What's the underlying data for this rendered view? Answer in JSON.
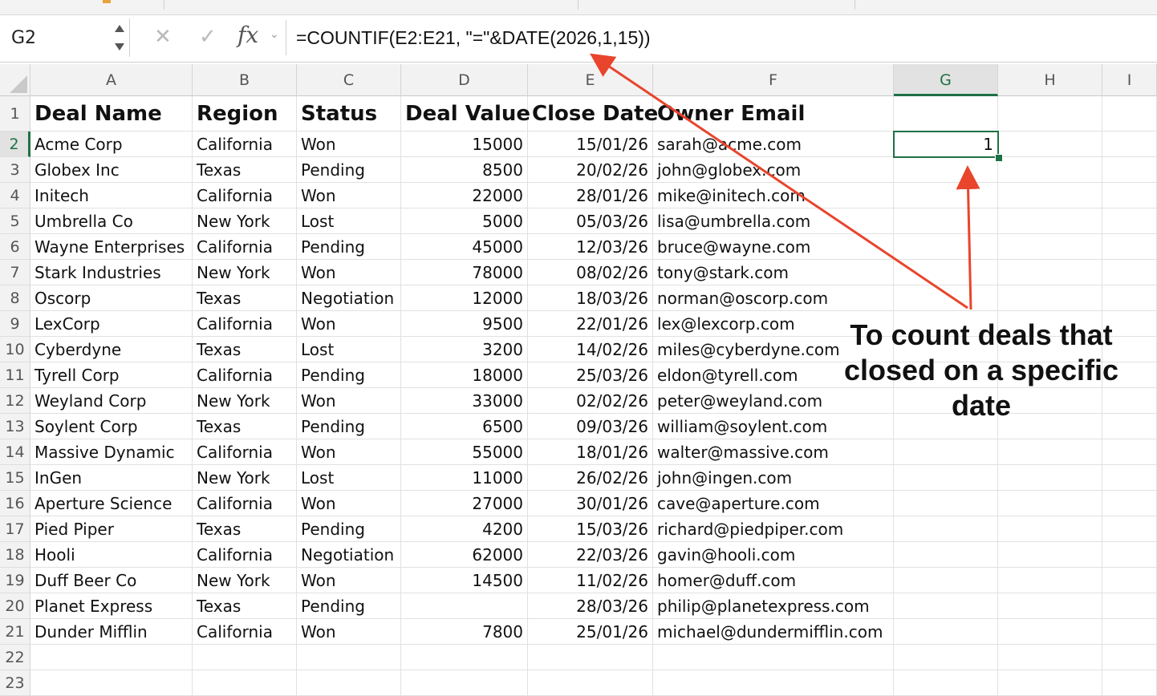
{
  "formula_bar": {
    "name_box": "G2",
    "fx_label": "fx",
    "cancel_glyph": "✕",
    "enter_glyph": "✓",
    "formula": "=COUNTIF(E2:E21, \"=\"&DATE(2026,1,15))"
  },
  "columns": [
    {
      "letter": "A",
      "width": 202
    },
    {
      "letter": "B",
      "width": 130
    },
    {
      "letter": "C",
      "width": 130
    },
    {
      "letter": "D",
      "width": 158
    },
    {
      "letter": "E",
      "width": 156
    },
    {
      "letter": "F",
      "width": 300
    },
    {
      "letter": "G",
      "width": 130
    },
    {
      "letter": "H",
      "width": 130
    },
    {
      "letter": "I",
      "width": 68
    }
  ],
  "selected_cell": {
    "col": "G",
    "row": 2
  },
  "headers": [
    "Deal Name",
    "Region",
    "Status",
    "Deal Value",
    "Close Date",
    "Owner Email"
  ],
  "rows": [
    [
      "Acme Corp",
      "California",
      "Won",
      "15000",
      "15/01/26",
      "sarah@acme.com"
    ],
    [
      "Globex Inc",
      "Texas",
      "Pending",
      "8500",
      "20/02/26",
      "john@globex.com"
    ],
    [
      "Initech",
      "California",
      "Won",
      "22000",
      "28/01/26",
      "mike@initech.com"
    ],
    [
      "Umbrella Co",
      "New York",
      "Lost",
      "5000",
      "05/03/26",
      "lisa@umbrella.com"
    ],
    [
      "Wayne Enterprises",
      "California",
      "Pending",
      "45000",
      "12/03/26",
      "bruce@wayne.com"
    ],
    [
      "Stark Industries",
      "New York",
      "Won",
      "78000",
      "08/02/26",
      "tony@stark.com"
    ],
    [
      "Oscorp",
      "Texas",
      "Negotiation",
      "12000",
      "18/03/26",
      "norman@oscorp.com"
    ],
    [
      "LexCorp",
      "California",
      "Won",
      "9500",
      "22/01/26",
      "lex@lexcorp.com"
    ],
    [
      "Cyberdyne",
      "Texas",
      "Lost",
      "3200",
      "14/02/26",
      "miles@cyberdyne.com"
    ],
    [
      "Tyrell Corp",
      "California",
      "Pending",
      "18000",
      "25/03/26",
      "eldon@tyrell.com"
    ],
    [
      "Weyland Corp",
      "New York",
      "Won",
      "33000",
      "02/02/26",
      "peter@weyland.com"
    ],
    [
      "Soylent Corp",
      "Texas",
      "Pending",
      "6500",
      "09/03/26",
      "william@soylent.com"
    ],
    [
      "Massive Dynamic",
      "California",
      "Won",
      "55000",
      "18/01/26",
      "walter@massive.com"
    ],
    [
      "InGen",
      "New York",
      "Lost",
      "11000",
      "26/02/26",
      "john@ingen.com"
    ],
    [
      "Aperture Science",
      "California",
      "Won",
      "27000",
      "30/01/26",
      "cave@aperture.com"
    ],
    [
      "Pied Piper",
      "Texas",
      "Pending",
      "4200",
      "15/03/26",
      "richard@piedpiper.com"
    ],
    [
      "Hooli",
      "California",
      "Negotiation",
      "62000",
      "22/03/26",
      "gavin@hooli.com"
    ],
    [
      "Duff Beer Co",
      "New York",
      "Won",
      "14500",
      "11/02/26",
      "homer@duff.com"
    ],
    [
      "Planet Express",
      "Texas",
      "Pending",
      "",
      "28/03/26",
      "philip@planetexpress.com"
    ],
    [
      "Dunder Mifflin",
      "California",
      "Won",
      "7800",
      "25/01/26",
      "michael@dundermifflin.com"
    ]
  ],
  "result_cell": {
    "value": "1"
  },
  "row_numbers": [
    "1",
    "2",
    "3",
    "4",
    "5",
    "6",
    "7",
    "8",
    "9",
    "10",
    "11",
    "12",
    "13",
    "14",
    "15",
    "16",
    "17",
    "18",
    "19",
    "20",
    "21",
    "22",
    "23"
  ],
  "annotation": {
    "text": "To count deals that closed on a specific date",
    "arrow_color": "#e8452c"
  }
}
